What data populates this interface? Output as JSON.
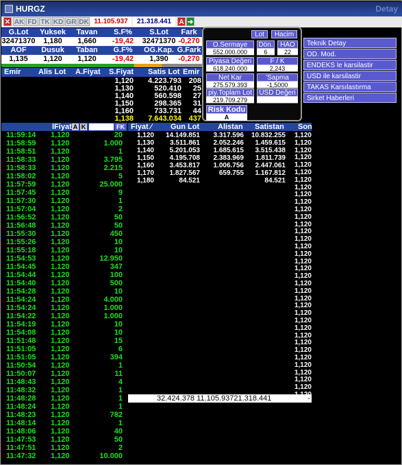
{
  "window": {
    "title": "HURGZ",
    "detay": "Detay"
  },
  "toolbar": {
    "buttons": [
      "AK",
      "FD",
      "TK",
      "KD",
      "GR",
      "DK"
    ],
    "price_change": "11.105.937",
    "volume": "21.318.441",
    "a_label": "A"
  },
  "summary": {
    "row1_headers": [
      "G.Lot",
      "Yuksek",
      "Tavan",
      "S.F%",
      "S.Lot",
      "Fark"
    ],
    "row1_values": [
      "32471370",
      "1,180",
      "1,660",
      "-19,42",
      "32471370",
      "-0,270"
    ],
    "row2_headers": [
      "AOF",
      "Dusuk",
      "Taban",
      "G.F%",
      "OG.Kap.",
      "G.Fark"
    ],
    "row2_values": [
      "1,135",
      "1,120",
      "1,120",
      "-19,42",
      "1,390",
      "-0,270"
    ]
  },
  "depth_header": [
    "Emir",
    "Alis Lot",
    "A.Fiyat",
    "S.Fiyat",
    "Satis Lot",
    "Emir"
  ],
  "depth_rows": [
    {
      "s_price": "1,120",
      "s_lot": "4.223.793",
      "emir": "208",
      "highlight": false
    },
    {
      "s_price": "1,130",
      "s_lot": "520.410",
      "emir": "25",
      "highlight": false
    },
    {
      "s_price": "1,140",
      "s_lot": "560.598",
      "emir": "27",
      "highlight": false
    },
    {
      "s_price": "1,150",
      "s_lot": "298.365",
      "emir": "31",
      "highlight": false
    },
    {
      "s_price": "1,160",
      "s_lot": "733.731",
      "emir": "44",
      "highlight": false
    },
    {
      "s_price": "1,138",
      "s_lot": "7.643.034",
      "emir": "437",
      "highlight": true
    }
  ],
  "info": {
    "buttons": [
      "Lot",
      "Hacim"
    ],
    "o_sermaye_label": "O.Sermaye",
    "o_sermaye_value": "552.000.000",
    "don_label": "Dön.",
    "don_value": "6",
    "hao_label": "HAO",
    "hao_value": "22",
    "piyasa_label": "Piyasa Değeri",
    "piyasa_value": "618.240.000",
    "fk_label": "F / K",
    "fk_value": "2,243",
    "netkar_label": "Net Kar",
    "netkar_value": "275.579.393",
    "sapma_label": "'Sapma",
    "sapma_value": "-1,5000",
    "toplam_label": "piy.Toplam Lot",
    "toplam_value": "219.709.279",
    "usd_label": "USD Değeri",
    "risk_label": "Risk Kodu",
    "risk_value": "A"
  },
  "menu": [
    "Teknik Detay",
    "OD. Mod.",
    "ENDEKS le karsilastir",
    "USD ile karsilastir",
    "TAKAS Karsılastırma",
    "Sirket Haberleri"
  ],
  "trades_header": {
    "fiyat": "lFiyat",
    "a": "A",
    "k": "K",
    "fk": "FK"
  },
  "trades": [
    {
      "time": "11:59:14",
      "price": "1,120",
      "lot": "20"
    },
    {
      "time": "11:58:59",
      "price": "1,120",
      "lot": "1.000"
    },
    {
      "time": "11:58:51",
      "price": "1,120",
      "lot": "1"
    },
    {
      "time": "11:58:33",
      "price": "1,120",
      "lot": "3.795"
    },
    {
      "time": "11:58:33",
      "price": "1,120",
      "lot": "2.215"
    },
    {
      "time": "11:58:02",
      "price": "1,120",
      "lot": "5"
    },
    {
      "time": "11:57:59",
      "price": "1,120",
      "lot": "25.000"
    },
    {
      "time": "11:57:45",
      "price": "1,120",
      "lot": "9"
    },
    {
      "time": "11:57:30",
      "price": "1,120",
      "lot": "1"
    },
    {
      "time": "11:57:04",
      "price": "1,120",
      "lot": "2"
    },
    {
      "time": "11:56:52",
      "price": "1,120",
      "lot": "50"
    },
    {
      "time": "11:56:48",
      "price": "1,120",
      "lot": "50"
    },
    {
      "time": "11:55:30",
      "price": "1,120",
      "lot": "450"
    },
    {
      "time": "11:55:26",
      "price": "1,120",
      "lot": "10"
    },
    {
      "time": "11:55:18",
      "price": "1,120",
      "lot": "10"
    },
    {
      "time": "11:54:53",
      "price": "1,120",
      "lot": "12.950"
    },
    {
      "time": "11:54:45",
      "price": "1,120",
      "lot": "347"
    },
    {
      "time": "11:54:44",
      "price": "1,120",
      "lot": "100"
    },
    {
      "time": "11:54:40",
      "price": "1,120",
      "lot": "500"
    },
    {
      "time": "11:54:28",
      "price": "1,120",
      "lot": "10"
    },
    {
      "time": "11:54:24",
      "price": "1,120",
      "lot": "4.000"
    },
    {
      "time": "11:54:24",
      "price": "1,120",
      "lot": "1.000"
    },
    {
      "time": "11:54:22",
      "price": "1,120",
      "lot": "1.000"
    },
    {
      "time": "11:54:19",
      "price": "1,120",
      "lot": "10"
    },
    {
      "time": "11:54:08",
      "price": "1,120",
      "lot": "10"
    },
    {
      "time": "11:51:48",
      "price": "1,120",
      "lot": "15"
    },
    {
      "time": "11:51:05",
      "price": "1,120",
      "lot": "6"
    },
    {
      "time": "11:51:05",
      "price": "1,120",
      "lot": "394"
    },
    {
      "time": "11:50:54",
      "price": "1,120",
      "lot": "1"
    },
    {
      "time": "11:50:07",
      "price": "1,120",
      "lot": "11"
    },
    {
      "time": "11:48:43",
      "price": "1,120",
      "lot": "4"
    },
    {
      "time": "11:48:32",
      "price": "1,120",
      "lot": "1"
    },
    {
      "time": "11:48:28",
      "price": "1,120",
      "lot": "1"
    },
    {
      "time": "11:48:24",
      "price": "1,120",
      "lot": "1"
    },
    {
      "time": "11:48:23",
      "price": "1,120",
      "lot": "782"
    },
    {
      "time": "11:48:14",
      "price": "1,120",
      "lot": "1"
    },
    {
      "time": "11:48:06",
      "price": "1,120",
      "lot": "40"
    },
    {
      "time": "11:47:53",
      "price": "1,120",
      "lot": "50"
    },
    {
      "time": "11:47:51",
      "price": "1,120",
      "lot": "2"
    },
    {
      "time": "11:47:32",
      "price": "1,120",
      "lot": "10.000"
    }
  ],
  "volume_header": [
    "Fiyat",
    "Gun Lot",
    "Alistan",
    "Satistan",
    "Son"
  ],
  "volume_rows": [
    {
      "fiyat": "1,120",
      "gun_lot": "14.149.851",
      "alistan": "3.317.596",
      "satistan": "10.832.255"
    },
    {
      "fiyat": "1,130",
      "gun_lot": "3.511.861",
      "alistan": "2.052.246",
      "satistan": "1.459.615"
    },
    {
      "fiyat": "1,140",
      "gun_lot": "5.201.053",
      "alistan": "1.685.615",
      "satistan": "3.515.438"
    },
    {
      "fiyat": "1,150",
      "gun_lot": "4.195.708",
      "alistan": "2.383.969",
      "satistan": "1.811.739"
    },
    {
      "fiyat": "1,160",
      "gun_lot": "3.453.817",
      "alistan": "1.006.756",
      "satistan": "2.447.061"
    },
    {
      "fiyat": "1,170",
      "gun_lot": "1.827.567",
      "alistan": "659.755",
      "satistan": "1.167.812"
    },
    {
      "fiyat": "1,180",
      "gun_lot": "84.521",
      "alistan": "",
      "satistan": "84.521"
    }
  ],
  "son_values": [
    "1,120",
    "1,120",
    "1,120",
    "1,120",
    "1,120",
    "1,120",
    "1,120",
    "1,120",
    "1,120",
    "1,120",
    "1,120",
    "1,120",
    "1,120",
    "1,120",
    "1,120",
    "1,120",
    "1,120",
    "1,120",
    "1,120",
    "1,120",
    "1,120",
    "1,120",
    "1,120",
    "1,120",
    "1,120",
    "1,120",
    "1,120",
    "1,120",
    "1,120",
    "1,120",
    "1,120",
    "1,120",
    "1,120",
    "1,120",
    "1,120",
    "1,120"
  ],
  "totals": {
    "text": "32.424.378 11.105.93721.318.441",
    "dash": "-"
  }
}
